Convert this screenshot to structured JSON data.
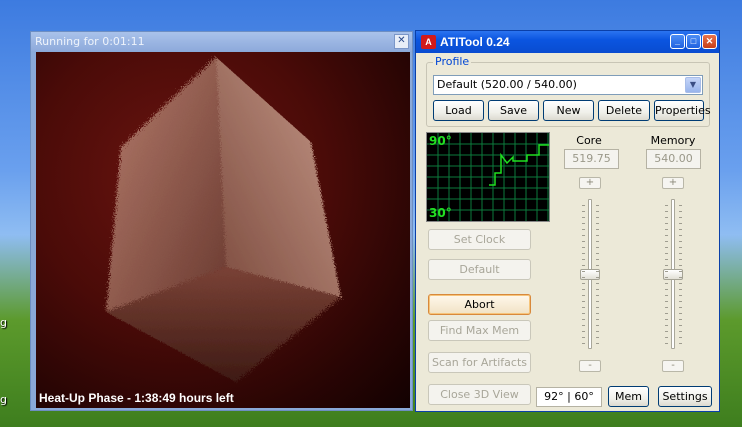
{
  "desktop": {
    "label_fragment_1": "g",
    "label_fragment_2": "g"
  },
  "render_window": {
    "title": "Running for 0:01:11",
    "close_glyph": "✕",
    "caption": "Heat-Up Phase - 1:38:49 hours left"
  },
  "atitool": {
    "title": "ATITool 0.24",
    "logo_glyph": "A",
    "minimize_glyph": "_",
    "maximize_glyph": "□",
    "close_glyph": "✕",
    "profile": {
      "group_label": "Profile",
      "selected": "Default (520.00 / 540.00)",
      "dropdown_glyph": "▼",
      "buttons": {
        "load": "Load",
        "save": "Save",
        "new": "New",
        "delete": "Delete",
        "properties": "Properties"
      }
    },
    "graph": {
      "top_label": "90°",
      "bottom_label": "30°",
      "line_color": "#20e020",
      "grid_color": "#0c7a3c"
    },
    "core": {
      "label": "Core",
      "value": "519.75",
      "plus": "+",
      "minus": "-",
      "slider_level_fraction": 0.5
    },
    "memory": {
      "label": "Memory",
      "value": "540.00",
      "plus": "+",
      "minus": "-",
      "slider_level_fraction": 0.5
    },
    "actions": {
      "set_clock": "Set Clock",
      "default": "Default",
      "abort": "Abort",
      "find_max_mem": "Find Max Mem",
      "scan_for_artifacts": "Scan for Artifacts",
      "close_3d_view": "Close 3D View"
    },
    "temperature_readout": "92° | 60°",
    "mem_button": "Mem",
    "settings_button": "Settings"
  }
}
